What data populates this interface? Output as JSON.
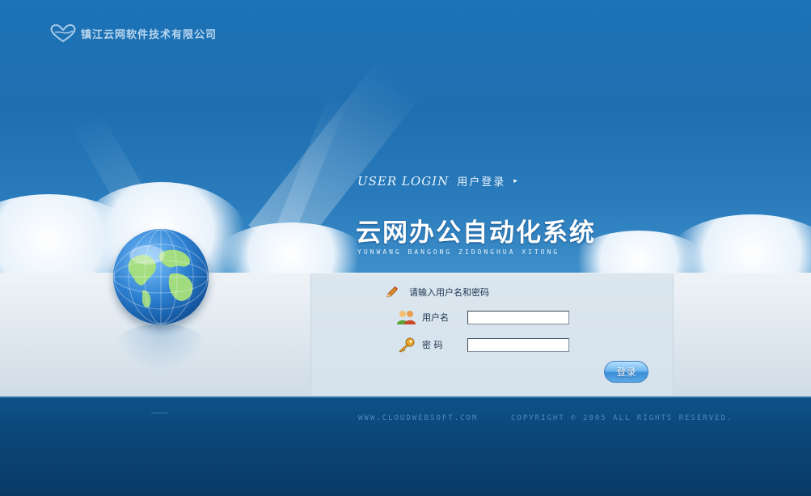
{
  "company": {
    "name": "镇江云网软件技术有限公司",
    "logo_icon": "heart-logo-icon"
  },
  "login_header": {
    "en": "USER LOGIN",
    "cn": "用户登录",
    "arrow": "▸"
  },
  "system": {
    "title": "云网办公自动化系统",
    "subtitle": "YUNWANG BANGONG ZIDONGHUA XITONG"
  },
  "form": {
    "hint": "请输入用户名和密码",
    "username_label": "用户名",
    "username_value": "",
    "password_label": "密 码",
    "password_value": "",
    "submit_label": "登录"
  },
  "footer": {
    "website": "WWW.CLOUDWEBSOFT.COM",
    "copyright": "COPYRIGHT © 2005 ALL RIGHTS RESERVED."
  },
  "colors": {
    "sky": "#1c73b8",
    "panel": "#dbe6ef",
    "footer_bg": "#0b4678",
    "footer_text": "#4f8ac0",
    "button": "#3c8fd7"
  }
}
